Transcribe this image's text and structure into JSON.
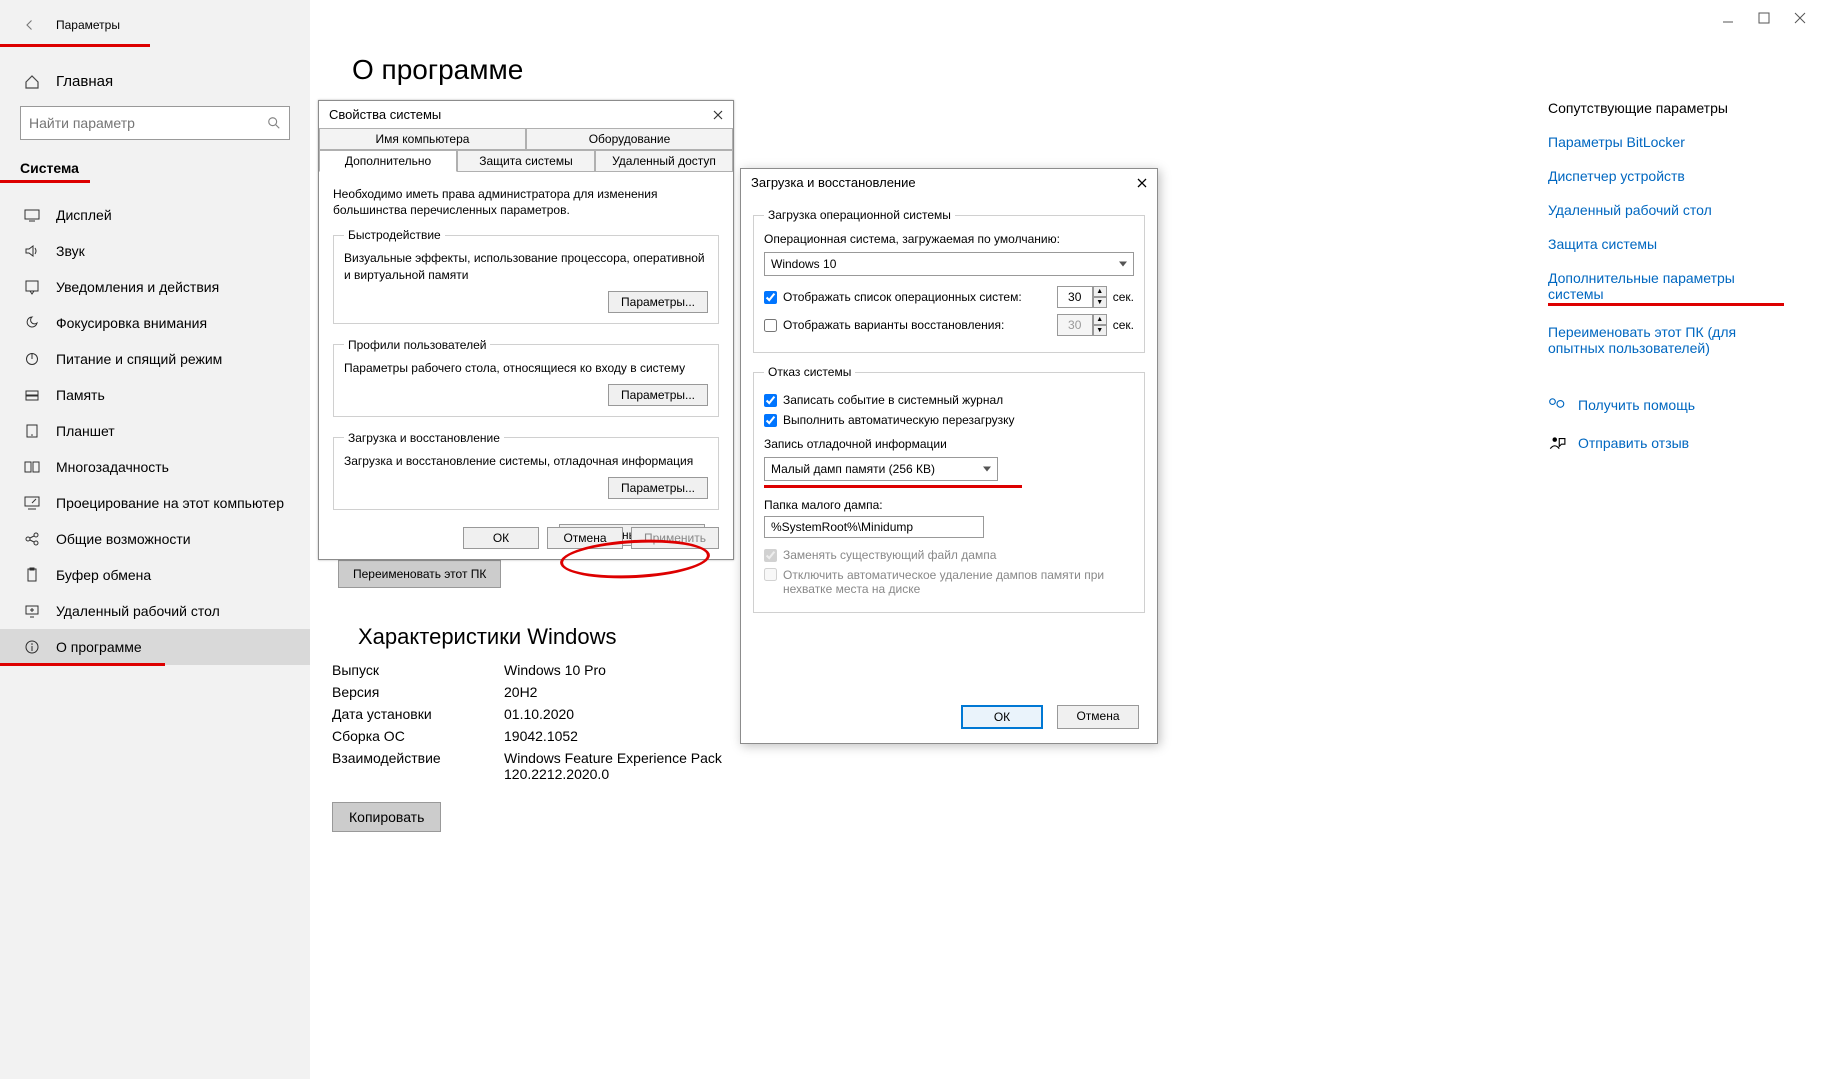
{
  "header": {
    "title": "Параметры"
  },
  "sidebar": {
    "home": "Главная",
    "search_placeholder": "Найти параметр",
    "system_label": "Система",
    "items": [
      {
        "label": "Дисплей"
      },
      {
        "label": "Звук"
      },
      {
        "label": "Уведомления и действия"
      },
      {
        "label": "Фокусировка внимания"
      },
      {
        "label": "Питание и спящий режим"
      },
      {
        "label": "Память"
      },
      {
        "label": "Планшет"
      },
      {
        "label": "Многозадачность"
      },
      {
        "label": "Проецирование на этот компьютер"
      },
      {
        "label": "Общие возможности"
      },
      {
        "label": "Буфер обмена"
      },
      {
        "label": "Удаленный рабочий стол"
      },
      {
        "label": "О программе"
      }
    ]
  },
  "main": {
    "page_title": "О программе",
    "rename_label": "Переименовать этот ПК",
    "specs_heading": "Характеристики Windows",
    "specs": {
      "edition_k": "Выпуск",
      "edition_v": "Windows 10 Pro",
      "version_k": "Версия",
      "version_v": "20H2",
      "installed_k": "Дата установки",
      "installed_v": "01.10.2020",
      "build_k": "Сборка ОС",
      "build_v": "19042.1052",
      "exp_k": "Взаимодействие",
      "exp_v": "Windows Feature Experience Pack 120.2212.2020.0"
    },
    "copy_label": "Копировать"
  },
  "related": {
    "heading": "Сопутствующие параметры",
    "links": {
      "bitlocker": "Параметры BitLocker",
      "devmgr": "Диспетчер устройств",
      "rdp": "Удаленный рабочий стол",
      "sysprotect": "Защита системы",
      "advsys": "Дополнительные параметры системы",
      "rename": "Переименовать этот ПК (для опытных пользователей)"
    },
    "help": "Получить помощь",
    "feedback": "Отправить отзыв"
  },
  "dlg1": {
    "title": "Свойства системы",
    "tabs": {
      "computer_name": "Имя компьютера",
      "hardware": "Оборудование",
      "advanced": "Дополнительно",
      "sysprotect": "Защита системы",
      "remote": "Удаленный доступ"
    },
    "admin_note": "Необходимо иметь права администратора для изменения большинства перечисленных параметров.",
    "perf_legend": "Быстродействие",
    "perf_text": "Визуальные эффекты, использование процессора, оперативной и виртуальной памяти",
    "profiles_legend": "Профили пользователей",
    "profiles_text": "Параметры рабочего стола, относящиеся ко входу в систему",
    "startup_legend": "Загрузка и восстановление",
    "startup_text": "Загрузка и восстановление системы, отладочная информация",
    "settings_btn": "Параметры...",
    "env_btn": "Переменные среды...",
    "ok": "ОК",
    "cancel": "Отмена",
    "apply": "Применить"
  },
  "dlg2": {
    "title": "Загрузка и восстановление",
    "boot_legend": "Загрузка операционной системы",
    "default_os_label": "Операционная система, загружаемая по умолчанию:",
    "default_os_value": "Windows 10",
    "show_os_list": "Отображать список операционных систем:",
    "show_recovery": "Отображать варианты восстановления:",
    "seconds1": "30",
    "seconds2": "30",
    "seconds_unit": "сек.",
    "failure_legend": "Отказ системы",
    "write_event": "Записать событие в системный журнал",
    "auto_restart": "Выполнить автоматическую перезагрузку",
    "dump_label": "Запись отладочной информации",
    "dump_value": "Малый дамп памяти (256 КВ)",
    "dump_folder_label": "Папка малого дампа:",
    "dump_folder_value": "%SystemRoot%\\Minidump",
    "overwrite_label": "Заменять существующий файл дампа",
    "disable_autodel": "Отключить автоматическое удаление дампов памяти при нехватке места на диске",
    "ok": "ОК",
    "cancel": "Отмена"
  }
}
